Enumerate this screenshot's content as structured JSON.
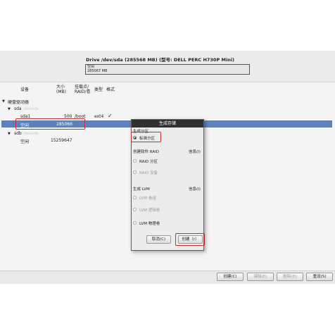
{
  "drive": {
    "title": "Drive /dev/sda (285568 MB) (型号: DELL PERC H730P Mini)",
    "bar_label": "空闲",
    "bar_size": "285067 MB"
  },
  "table": {
    "headers": {
      "device": "设备",
      "size": "大小\n(MB)",
      "mount": "挂载点/\nRAID/卷",
      "type": "类型",
      "format": "格式"
    },
    "group_label": "硬盘驱动器",
    "rows": {
      "sda": {
        "device": "sda",
        "sub": "/dev/sda"
      },
      "sda1": {
        "device": "sda1",
        "size": "500",
        "mount": "/boot",
        "type": "ext4",
        "format": "✓"
      },
      "sda_free": {
        "device": "空闲",
        "size": "285066"
      },
      "sdb": {
        "device": "sdb",
        "sub": "/dev/sdb"
      },
      "sdb_free": {
        "device": "空闲",
        "size": "15259647"
      }
    }
  },
  "dialog": {
    "title": "生成存储",
    "section_partition": "生成分区",
    "option_standard": "标准分区",
    "section_raid": "创建软件 RAID",
    "raid_info": "信息(I)",
    "option_raid_partition": "RAID 分区",
    "option_raid_device": "RAID 设备",
    "section_lvm": "生成 LVM",
    "lvm_info": "信息(I)",
    "option_lvm_vg": "LVM 卷组",
    "option_lvm_lv": "LVM 逻辑卷",
    "option_lvm_pv": "LVM 物理卷",
    "cancel": "取消(C)",
    "create": "创建（r）"
  },
  "toolbar": {
    "create": "创建(C)",
    "edit": "编辑(E)",
    "delete": "删除(D)",
    "reset": "重设(S)"
  }
}
